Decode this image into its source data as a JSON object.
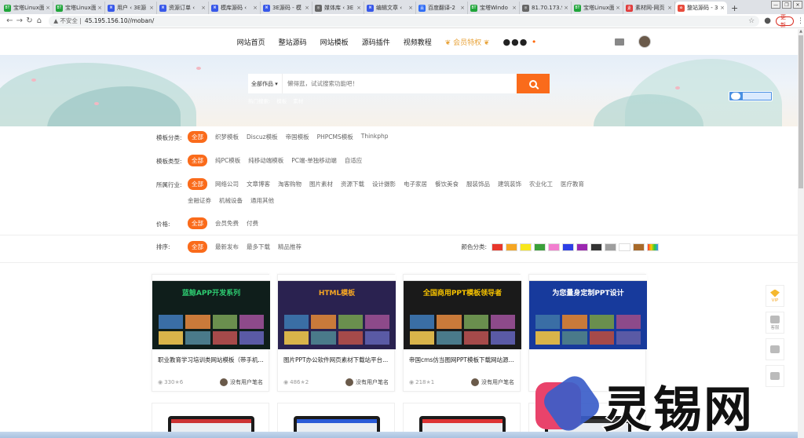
{
  "browser": {
    "tabs": [
      {
        "favicon": "BT",
        "color": "#20a53a",
        "title": "宝塔Linux面"
      },
      {
        "favicon": "BT",
        "color": "#20a53a",
        "title": "宝塔Linux面"
      },
      {
        "favicon": "W",
        "color": "#3858e9",
        "title": "用户 ‹ 3E源"
      },
      {
        "favicon": "W",
        "color": "#3858e9",
        "title": "资源订单 ‹"
      },
      {
        "favicon": "W",
        "color": "#3858e9",
        "title": "模库源码 ‹"
      },
      {
        "favicon": "W",
        "color": "#3858e9",
        "title": "3E源码 - 模"
      },
      {
        "favicon": "◎",
        "color": "#666666",
        "title": "媒体库 ‹ 3E"
      },
      {
        "favicon": "W",
        "color": "#3858e9",
        "title": "编辑文章 ‹"
      },
      {
        "favicon": "百",
        "color": "#2f6cf5",
        "title": "百度翻译-2"
      },
      {
        "favicon": "BT",
        "color": "#20a53a",
        "title": "宝塔Windo"
      },
      {
        "favicon": "◎",
        "color": "#666666",
        "title": "81.70.173.9"
      },
      {
        "favicon": "BT",
        "color": "#20a53a",
        "title": "宝塔Linux面"
      },
      {
        "favicon": "素",
        "color": "#e03a3a",
        "title": "素材网-网页"
      },
      {
        "favicon": "✿",
        "color": "#e84c3d",
        "title": "整站源码 - 3"
      }
    ],
    "new_tab": "+",
    "insecure_label": "不安全",
    "url": "45.195.156.10//moban/",
    "update_label": "更新"
  },
  "site": {
    "nav": [
      "网站首页",
      "整站源码",
      "网站模板",
      "源码插件",
      "视频教程"
    ],
    "vip_label": "会员特权",
    "more": "●●●"
  },
  "search": {
    "category": "全部作品",
    "placeholder": "懒得逛，试试搜索功能吧！",
    "hotwords": [
      "热门搜索:",
      "模板",
      "素材"
    ]
  },
  "filters": {
    "template_category": {
      "label": "模板分类:",
      "options": [
        "全部",
        "织梦模板",
        "Discuz模板",
        "帝国模板",
        "PHPCMS模板",
        "Thinkphp"
      ]
    },
    "template_type": {
      "label": "模板类型:",
      "options": [
        "全部",
        "纯PC模板",
        "纯移动端模板",
        "PC端-单独移动端",
        "自适应"
      ]
    },
    "industry": {
      "label": "所属行业:",
      "options": [
        "全部",
        "网络公司",
        "文章博客",
        "淘客购物",
        "图片素材",
        "资源下载",
        "设计摄影",
        "电子家居",
        "餐饮美食",
        "服装饰品",
        "建筑装饰",
        "农业化工",
        "医疗教育",
        "金融证券",
        "机械设备",
        "通用其他"
      ]
    },
    "price": {
      "label": "价格:",
      "options": [
        "全部",
        "会员免费",
        "付费"
      ]
    },
    "sort": {
      "label": "排序:",
      "options": [
        "全部",
        "最新发布",
        "最多下载",
        "精品推荐"
      ]
    },
    "color_label": "颜色分类:",
    "colors": [
      "#e8372c",
      "#f5a623",
      "#f8e71c",
      "#3aa03a",
      "#f27ecf",
      "#2d3fe6",
      "#9b27b0",
      "#333333",
      "#9e9e9e",
      "#ffffff",
      "#a86a2a",
      "#ff9800"
    ]
  },
  "cards": [
    {
      "title": "职业教育学习培训类网站模板（带手机...",
      "views": "330",
      "stars": "6",
      "author": "没有用户笔名",
      "thumb_bg": "#0f1e1b",
      "thumb_banner": "蓝鲸APP开发系列",
      "accent": "#2ecc71"
    },
    {
      "title": "图片PPT办公软件网页素材下载站平台...",
      "views": "486",
      "stars": "2",
      "author": "没有用户笔名",
      "thumb_bg": "#2a2250",
      "thumb_banner": "HTML模板",
      "accent": "#f5a623"
    },
    {
      "title": "帝国cms仿当图网PPT模板下载网站源...",
      "views": "218",
      "stars": "1",
      "author": "没有用户笔名",
      "thumb_bg": "#1a1a1a",
      "thumb_banner": "全国商用PPT模板领导者",
      "accent": "#f5c100"
    },
    {
      "title": "",
      "views": "",
      "stars": "",
      "author": "",
      "thumb_bg": "#173a9c",
      "thumb_banner": "为您量身定制PPT设计",
      "accent": "#ffffff"
    }
  ],
  "side_tools": [
    {
      "icon": "diamond-icon",
      "label": "VIP"
    },
    {
      "icon": "user-icon",
      "label": "客服"
    },
    {
      "icon": "chat-icon",
      "label": ""
    },
    {
      "icon": "settings-icon",
      "label": ""
    }
  ],
  "watermark": {
    "text": "灵锡网"
  }
}
